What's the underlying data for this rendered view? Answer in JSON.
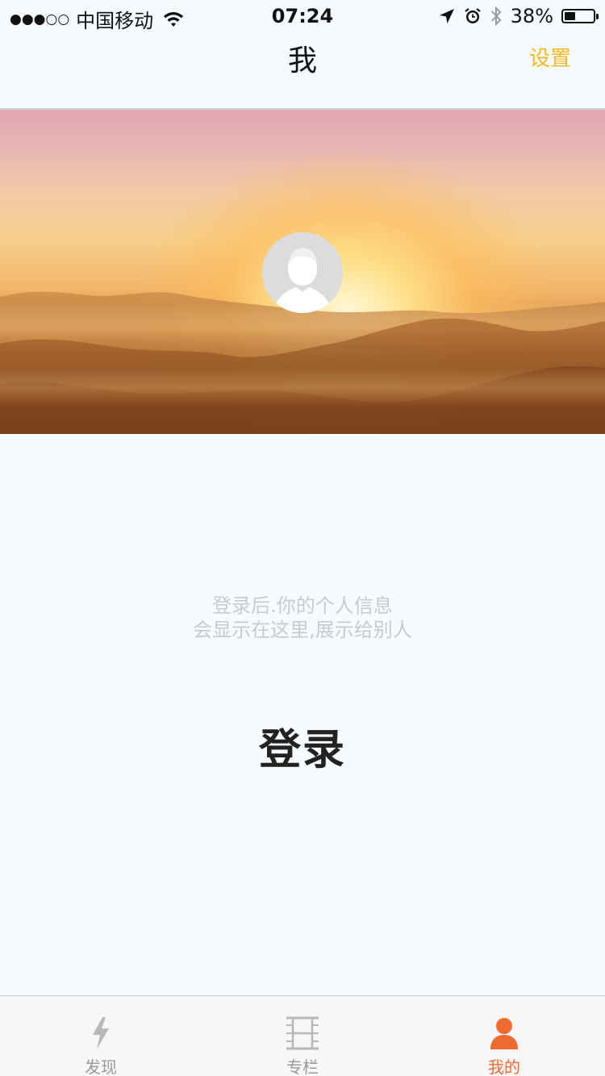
{
  "status_bar": {
    "signal": "●●●○○",
    "carrier": "中国移动",
    "time": "07:24",
    "battery_percent_text": "38%",
    "battery_level": 0.38,
    "icons": [
      "wifi-icon",
      "location-arrow-icon",
      "alarm-icon",
      "bluetooth-icon",
      "battery-icon"
    ]
  },
  "nav": {
    "title": "我",
    "settings_label": "设置",
    "settings_color": "#f5b820"
  },
  "profile": {
    "avatar_icon": "default-avatar-icon",
    "banner": "sunrise-over-mountains"
  },
  "main": {
    "hint_line1": "登录后.你的个人信息",
    "hint_line2": "会显示在这里,展示给别人",
    "login_label": "登录"
  },
  "tab_bar": {
    "active_color": "#ee6a30",
    "inactive_color": "#9a9a9a",
    "items": [
      {
        "label": "发现",
        "icon": "lightning-icon",
        "active": false
      },
      {
        "label": "专栏",
        "icon": "film-icon",
        "active": false
      },
      {
        "label": "我的",
        "icon": "person-icon",
        "active": true
      }
    ]
  }
}
